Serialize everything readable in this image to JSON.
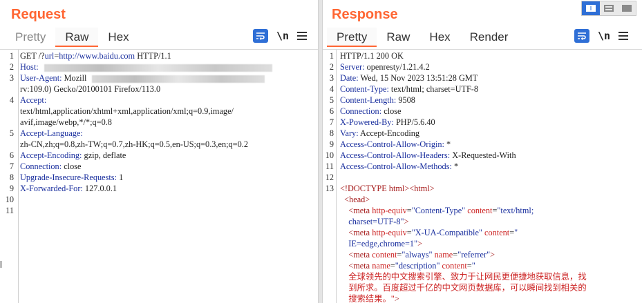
{
  "request": {
    "title": "Request",
    "tabs": [
      "Pretty",
      "Raw",
      "Hex"
    ],
    "active_tab": "Raw",
    "tools": {
      "wrap_icon": "wrap-lines-icon",
      "newline_label": "\\n",
      "menu_icon": "hamburger-menu-icon"
    },
    "lines": [
      {
        "n": "1",
        "parts": [
          {
            "t": "GET /?",
            "c": "v"
          },
          {
            "t": "url",
            "c": "k"
          },
          {
            "t": "=",
            "c": "v"
          },
          {
            "t": "http://www.",
            "c": "k"
          },
          {
            "t": "baidu.com",
            "c": "k"
          },
          {
            "t": " HTTP/1.1",
            "c": "v"
          }
        ]
      },
      {
        "n": "2",
        "parts": [
          {
            "t": "Host:",
            "c": "k"
          }
        ]
      },
      {
        "n": "3",
        "parts": [
          {
            "t": "User-Agent:",
            "c": "k"
          },
          {
            "t": " Mozill",
            "c": "v"
          }
        ]
      },
      {
        "n": "",
        "parts": [
          {
            "t": "rv:109.0) Gecko/20100101 Firefox/113.0",
            "c": "v"
          }
        ]
      },
      {
        "n": "4",
        "parts": [
          {
            "t": "Accept:",
            "c": "k"
          }
        ]
      },
      {
        "n": "",
        "parts": [
          {
            "t": "text/html,application/xhtml+xml,application/xml;q=0.9,image/",
            "c": "v"
          }
        ]
      },
      {
        "n": "",
        "parts": [
          {
            "t": "avif,image/webp,*/*;q=0.8",
            "c": "v"
          }
        ]
      },
      {
        "n": "5",
        "parts": [
          {
            "t": "Accept-Language:",
            "c": "k"
          }
        ]
      },
      {
        "n": "",
        "parts": [
          {
            "t": "zh-CN,zh;q=0.8,zh-TW;q=0.7,zh-HK;q=0.5,en-US;q=0.3,en;q=0.2",
            "c": "v"
          }
        ]
      },
      {
        "n": "6",
        "parts": [
          {
            "t": "Accept-Encoding:",
            "c": "k"
          },
          {
            "t": " gzip, deflate",
            "c": "v"
          }
        ]
      },
      {
        "n": "7",
        "parts": [
          {
            "t": "Connection:",
            "c": "k"
          },
          {
            "t": " close",
            "c": "v"
          }
        ]
      },
      {
        "n": "8",
        "parts": [
          {
            "t": "Upgrade-Insecure-Requests:",
            "c": "k"
          },
          {
            "t": " 1",
            "c": "v"
          }
        ]
      },
      {
        "n": "9",
        "parts": [
          {
            "t": "X-Forwarded-For:",
            "c": "k"
          },
          {
            "t": " 127.0.0.1",
            "c": "v"
          }
        ]
      },
      {
        "n": "10",
        "parts": []
      },
      {
        "n": "11",
        "parts": []
      }
    ]
  },
  "response": {
    "title": "Response",
    "tabs": [
      "Pretty",
      "Raw",
      "Hex",
      "Render"
    ],
    "active_tab": "Pretty",
    "tools": {
      "wrap_icon": "wrap-lines-icon",
      "newline_label": "\\n",
      "menu_icon": "hamburger-menu-icon"
    },
    "lines": [
      {
        "n": "1",
        "parts": [
          {
            "t": "HTTP/1.1 200 OK",
            "c": "v"
          }
        ]
      },
      {
        "n": "2",
        "parts": [
          {
            "t": "Server:",
            "c": "k"
          },
          {
            "t": " openresty/1.21.4.2",
            "c": "v"
          }
        ]
      },
      {
        "n": "3",
        "parts": [
          {
            "t": "Date:",
            "c": "k"
          },
          {
            "t": " Wed, 15 Nov 2023 13:51:28 GMT",
            "c": "v"
          }
        ]
      },
      {
        "n": "4",
        "parts": [
          {
            "t": "Content-Type:",
            "c": "k"
          },
          {
            "t": " text/html; charset=UTF-8",
            "c": "v"
          }
        ]
      },
      {
        "n": "5",
        "parts": [
          {
            "t": "Content-Length:",
            "c": "k"
          },
          {
            "t": " 9508",
            "c": "v"
          }
        ]
      },
      {
        "n": "6",
        "parts": [
          {
            "t": "Connection:",
            "c": "k"
          },
          {
            "t": " close",
            "c": "v"
          }
        ]
      },
      {
        "n": "7",
        "parts": [
          {
            "t": "X-Powered-By:",
            "c": "k"
          },
          {
            "t": " PHP/5.6.40",
            "c": "v"
          }
        ]
      },
      {
        "n": "8",
        "parts": [
          {
            "t": "Vary:",
            "c": "k"
          },
          {
            "t": " Accept-Encoding",
            "c": "v"
          }
        ]
      },
      {
        "n": "9",
        "parts": [
          {
            "t": "Access-Control-Allow-Origin:",
            "c": "k"
          },
          {
            "t": " *",
            "c": "v"
          }
        ]
      },
      {
        "n": "10",
        "parts": [
          {
            "t": "Access-Control-Allow-Headers:",
            "c": "k"
          },
          {
            "t": " X-Requested-With",
            "c": "v"
          }
        ]
      },
      {
        "n": "11",
        "parts": [
          {
            "t": "Access-Control-Allow-Methods:",
            "c": "k"
          },
          {
            "t": " *",
            "c": "v"
          }
        ]
      },
      {
        "n": "12",
        "parts": []
      },
      {
        "n": "13",
        "parts": [
          {
            "t": "<!DOCTYPE html>",
            "c": "tag"
          },
          {
            "t": "<html>",
            "c": "tag"
          }
        ]
      },
      {
        "n": "",
        "parts": [
          {
            "t": "  <head>",
            "c": "tag"
          }
        ]
      },
      {
        "n": "",
        "parts": [
          {
            "t": "    <meta ",
            "c": "tag"
          },
          {
            "t": "http-equiv",
            "c": "attr"
          },
          {
            "t": "=",
            "c": "v"
          },
          {
            "t": "\"Content-Type\"",
            "c": "aval"
          },
          {
            "t": " content",
            "c": "attr"
          },
          {
            "t": "=",
            "c": "v"
          },
          {
            "t": "\"text/html;",
            "c": "aval"
          }
        ]
      },
      {
        "n": "",
        "parts": [
          {
            "t": "    charset=UTF-8\"",
            "c": "aval"
          },
          {
            "t": ">",
            "c": "tag"
          }
        ]
      },
      {
        "n": "",
        "parts": [
          {
            "t": "    <meta ",
            "c": "tag"
          },
          {
            "t": "http-equiv",
            "c": "attr"
          },
          {
            "t": "=",
            "c": "v"
          },
          {
            "t": "\"X-UA-Compatible\"",
            "c": "aval"
          },
          {
            "t": " content",
            "c": "attr"
          },
          {
            "t": "=",
            "c": "v"
          },
          {
            "t": "\"",
            "c": "aval"
          }
        ]
      },
      {
        "n": "",
        "parts": [
          {
            "t": "    IE=edge,chrome=1\"",
            "c": "aval"
          },
          {
            "t": ">",
            "c": "tag"
          }
        ]
      },
      {
        "n": "",
        "parts": [
          {
            "t": "    <meta ",
            "c": "tag"
          },
          {
            "t": "content",
            "c": "attr"
          },
          {
            "t": "=",
            "c": "v"
          },
          {
            "t": "\"always\"",
            "c": "aval"
          },
          {
            "t": " name",
            "c": "attr"
          },
          {
            "t": "=",
            "c": "v"
          },
          {
            "t": "\"referrer\"",
            "c": "aval"
          },
          {
            "t": ">",
            "c": "tag"
          }
        ]
      },
      {
        "n": "",
        "parts": [
          {
            "t": "    <meta ",
            "c": "tag"
          },
          {
            "t": "name",
            "c": "attr"
          },
          {
            "t": "=",
            "c": "v"
          },
          {
            "t": "\"description\"",
            "c": "aval"
          },
          {
            "t": " content",
            "c": "attr"
          },
          {
            "t": "=",
            "c": "v"
          },
          {
            "t": "\"",
            "c": "aval"
          }
        ]
      },
      {
        "n": "",
        "parts": [
          {
            "t": "    全球领先的中文搜索引擎、致力于让网民更便捷地获取信息，找",
            "c": "html-text"
          }
        ]
      },
      {
        "n": "",
        "parts": [
          {
            "t": "    到所求。百度超过千亿的中文网页数据库，可以瞬间找到相关的",
            "c": "html-text"
          }
        ]
      },
      {
        "n": "",
        "parts": [
          {
            "t": "    搜索结果。\"",
            "c": "html-text"
          },
          {
            "t": ">",
            "c": "tag"
          }
        ]
      }
    ]
  },
  "layout_switch": {
    "modes": [
      "side-by-side-icon",
      "stacked-icon",
      "single-pane-icon"
    ],
    "active": 0
  },
  "colors": {
    "accent": "#ff6633",
    "key": "#1a2f9e",
    "button_blue": "#2f6fd6"
  }
}
